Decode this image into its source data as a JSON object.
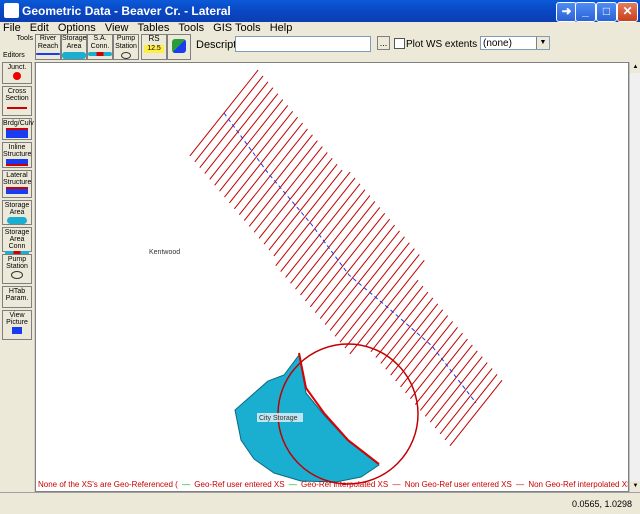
{
  "window": {
    "title": "Geometric Data - Beaver Cr.  - Lateral"
  },
  "menu": [
    "File",
    "Edit",
    "Options",
    "View",
    "Tables",
    "Tools",
    "GIS Tools",
    "Help"
  ],
  "toolbar": {
    "tools_label": "Tools",
    "editors_label": "Editors",
    "river_reach": "River Reach",
    "storage_area": "Storage Area",
    "sa_conn": "S.A. Conn.",
    "pump_station": "Pump Station",
    "rs_label": "RS",
    "rs_value": "12.5",
    "description_label": "Description :",
    "description_value": "",
    "plot_ws_label": "Plot WS extents for Profile:",
    "profile_value": "(none)"
  },
  "sidebar": [
    {
      "label": "Junct."
    },
    {
      "label": "Cross Section"
    },
    {
      "label": "Brdg/Culv"
    },
    {
      "label": "Inline Structure"
    },
    {
      "label": "Lateral Structure"
    },
    {
      "label": "Storage Area"
    },
    {
      "label": "Storage Area Conn"
    },
    {
      "label": "Pump Station"
    },
    {
      "label": "HTab Param."
    },
    {
      "label": "View Picture"
    }
  ],
  "map": {
    "kentwood_label": "Kentwood",
    "storage_label": "City Storage"
  },
  "legend": {
    "none_georef": "None of the XS's are Geo-Referenced (",
    "georef_user": "Geo-Ref user entered XS",
    "georef_interp": "Geo-Ref interpolated XS",
    "nongeo_user": "Non Geo-Ref user entered XS",
    "nongeo_interp": "Non Geo-Ref interpolated XS)"
  },
  "status": {
    "coords": "0.0565, 1.0298"
  },
  "colors": {
    "xs_line": "#c00000",
    "river": "#1a3cf0",
    "storage": "#1aaed0",
    "legend_text": "#cc0000"
  }
}
